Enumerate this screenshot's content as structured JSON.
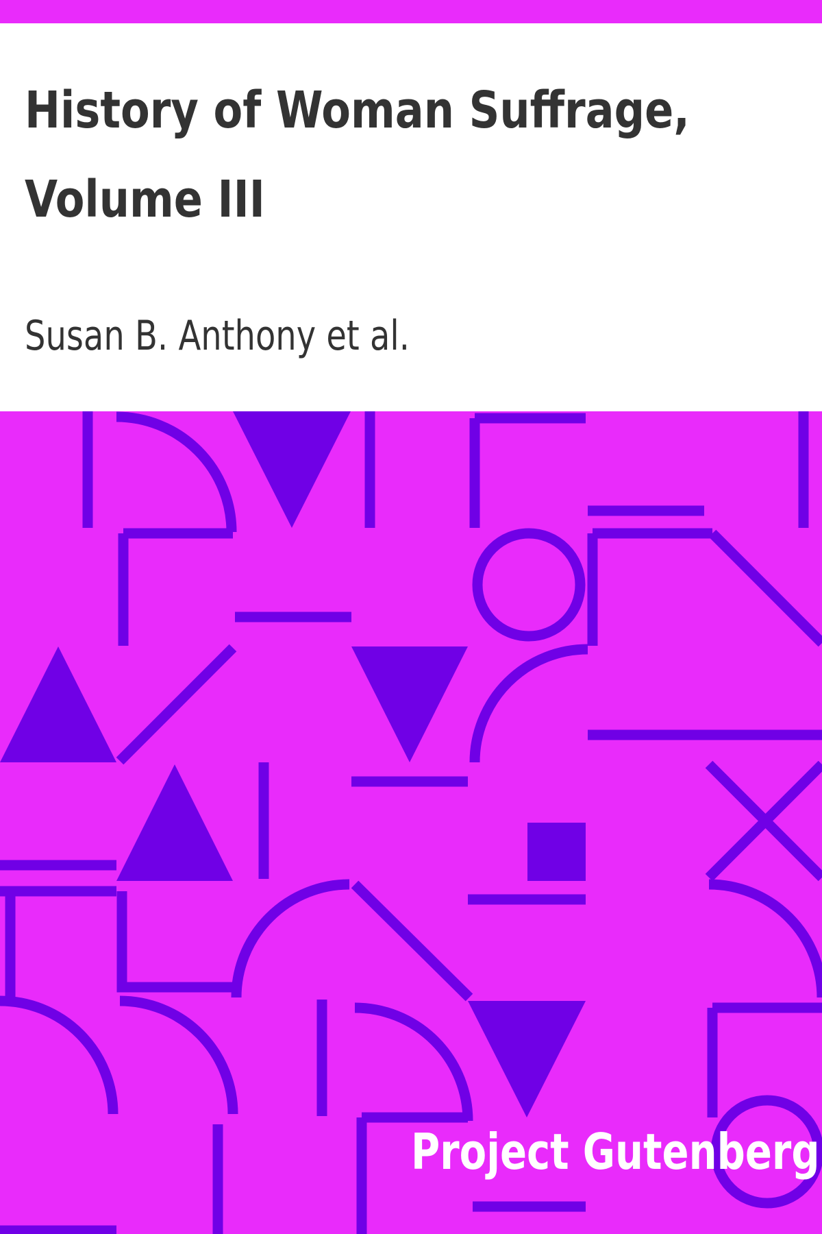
{
  "cover": {
    "title_line1": "History of Woman Suffrage,",
    "title_line2": "Volume III",
    "author": "Susan B. Anthony et al.",
    "publisher": "Project Gutenberg"
  },
  "colors": {
    "background": "#e92bfb",
    "pattern": "#7000e6",
    "title_panel": "#ffffff",
    "text_dark": "#333333",
    "text_light": "#ffffff"
  },
  "pattern_shapes": [
    "vertical-bar-shape",
    "quarter-arc-shape",
    "triangle-down-shape",
    "vertical-bar-shape",
    "corner-shape",
    "vertical-bar-shape",
    "horizontal-bar-shape",
    "corner-shape",
    "ring-shape",
    "corner-shape",
    "diagonal-bar-shape",
    "horizontal-bar-shape",
    "triangle-up-shape",
    "diagonal-bar-shape",
    "triangle-down-shape",
    "quarter-arc-shape",
    "horizontal-bar-shape",
    "vertical-bar-shape",
    "triangle-up-shape",
    "horizontal-bar-shape",
    "x-cross-shape",
    "square-shape",
    "horizontal-bar-shape",
    "corner-shape",
    "quarter-arc-shape",
    "diagonal-bar-shape",
    "quarter-arc-shape",
    "vertical-bar-shape",
    "quarter-arc-shape",
    "quarter-arc-shape",
    "corner-shape",
    "quarter-arc-shape",
    "triangle-down-shape",
    "vertical-bar-shape",
    "corner-shape",
    "vertical-bar-shape",
    "horizontal-bar-shape",
    "ring-shape",
    "horizontal-bar-shape"
  ]
}
